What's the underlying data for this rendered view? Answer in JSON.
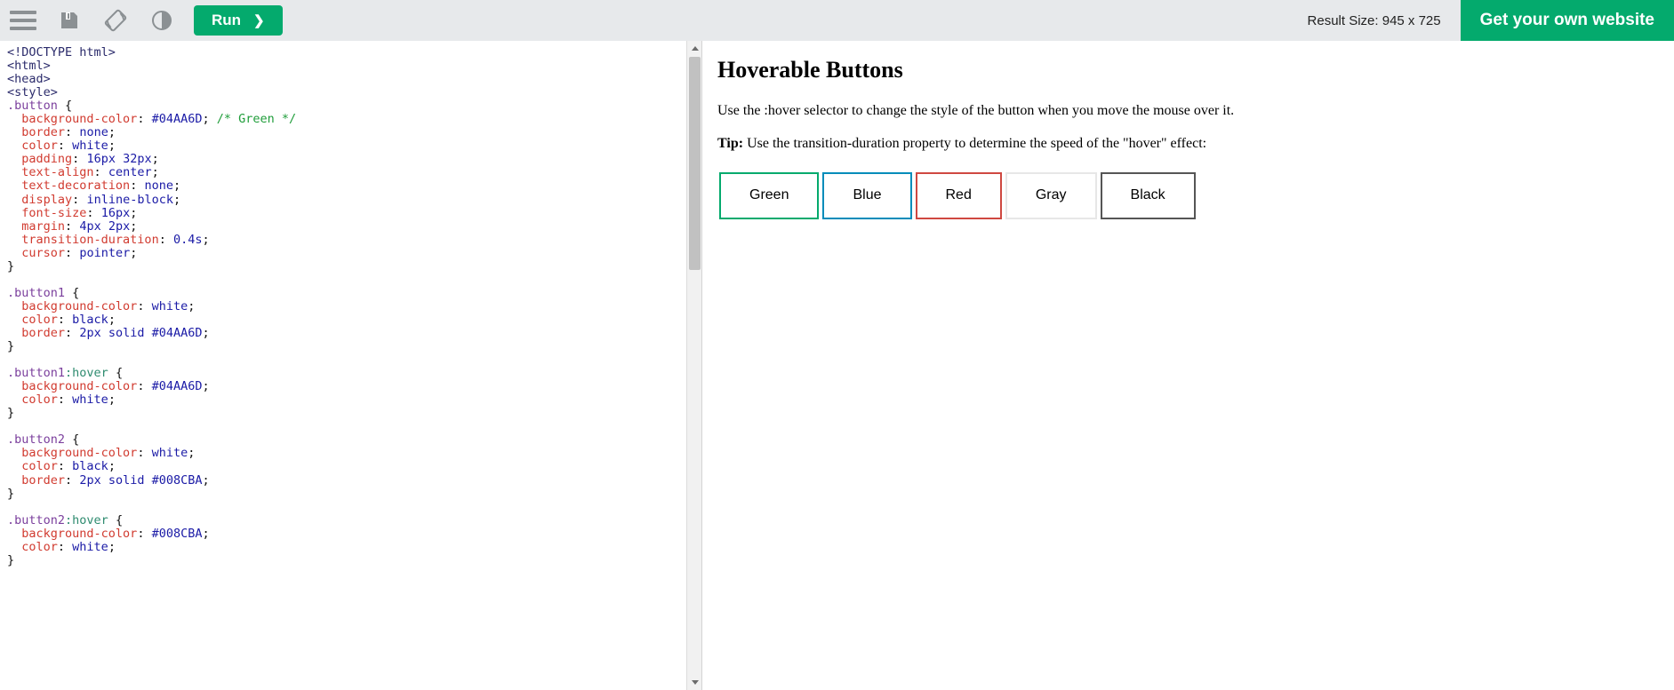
{
  "toolbar": {
    "menu_icon": "hamburger-menu-icon",
    "save_icon": "save-floppy-icon",
    "rotate_icon": "rotate-orientation-icon",
    "theme_icon": "dark-mode-contrast-icon",
    "run_label": "Run",
    "run_chevron": "❯",
    "result_size": "Result Size: 945 x 725",
    "get_website_label": "Get your own website"
  },
  "editor": {
    "scroll_up_arrow": "scroll-up-arrow",
    "scroll_down_arrow": "scroll-down-arrow",
    "code_lines": [
      "<!DOCTYPE html>",
      "<html>",
      "<head>",
      "<style>",
      ".button {",
      "  background-color: #04AA6D; /* Green */",
      "  border: none;",
      "  color: white;",
      "  padding: 16px 32px;",
      "  text-align: center;",
      "  text-decoration: none;",
      "  display: inline-block;",
      "  font-size: 16px;",
      "  margin: 4px 2px;",
      "  transition-duration: 0.4s;",
      "  cursor: pointer;",
      "}",
      "",
      ".button1 {",
      "  background-color: white;",
      "  color: black;",
      "  border: 2px solid #04AA6D;",
      "}",
      "",
      ".button1:hover {",
      "  background-color: #04AA6D;",
      "  color: white;",
      "}",
      "",
      ".button2 {",
      "  background-color: white;",
      "  color: black;",
      "  border: 2px solid #008CBA;",
      "}",
      "",
      ".button2:hover {",
      "  background-color: #008CBA;",
      "  color: white;",
      "}"
    ]
  },
  "preview": {
    "title": "Hoverable Buttons",
    "paragraph1": "Use the :hover selector to change the style of the button when you move the mouse over it.",
    "tip_label": "Tip:",
    "tip_text": " Use the transition-duration property to determine the speed of the \"hover\" effect:",
    "buttons": [
      {
        "label": "Green",
        "border_color": "#04AA6D"
      },
      {
        "label": "Blue",
        "border_color": "#008CBA"
      },
      {
        "label": "Red",
        "border_color": "#cf4841"
      },
      {
        "label": "Gray",
        "border_color": "#e7e7e7"
      },
      {
        "label": "Black",
        "border_color": "#555555"
      }
    ]
  },
  "colors": {
    "brand_green": "#04AA6D",
    "toolbar_bg": "#e7e9eb"
  }
}
